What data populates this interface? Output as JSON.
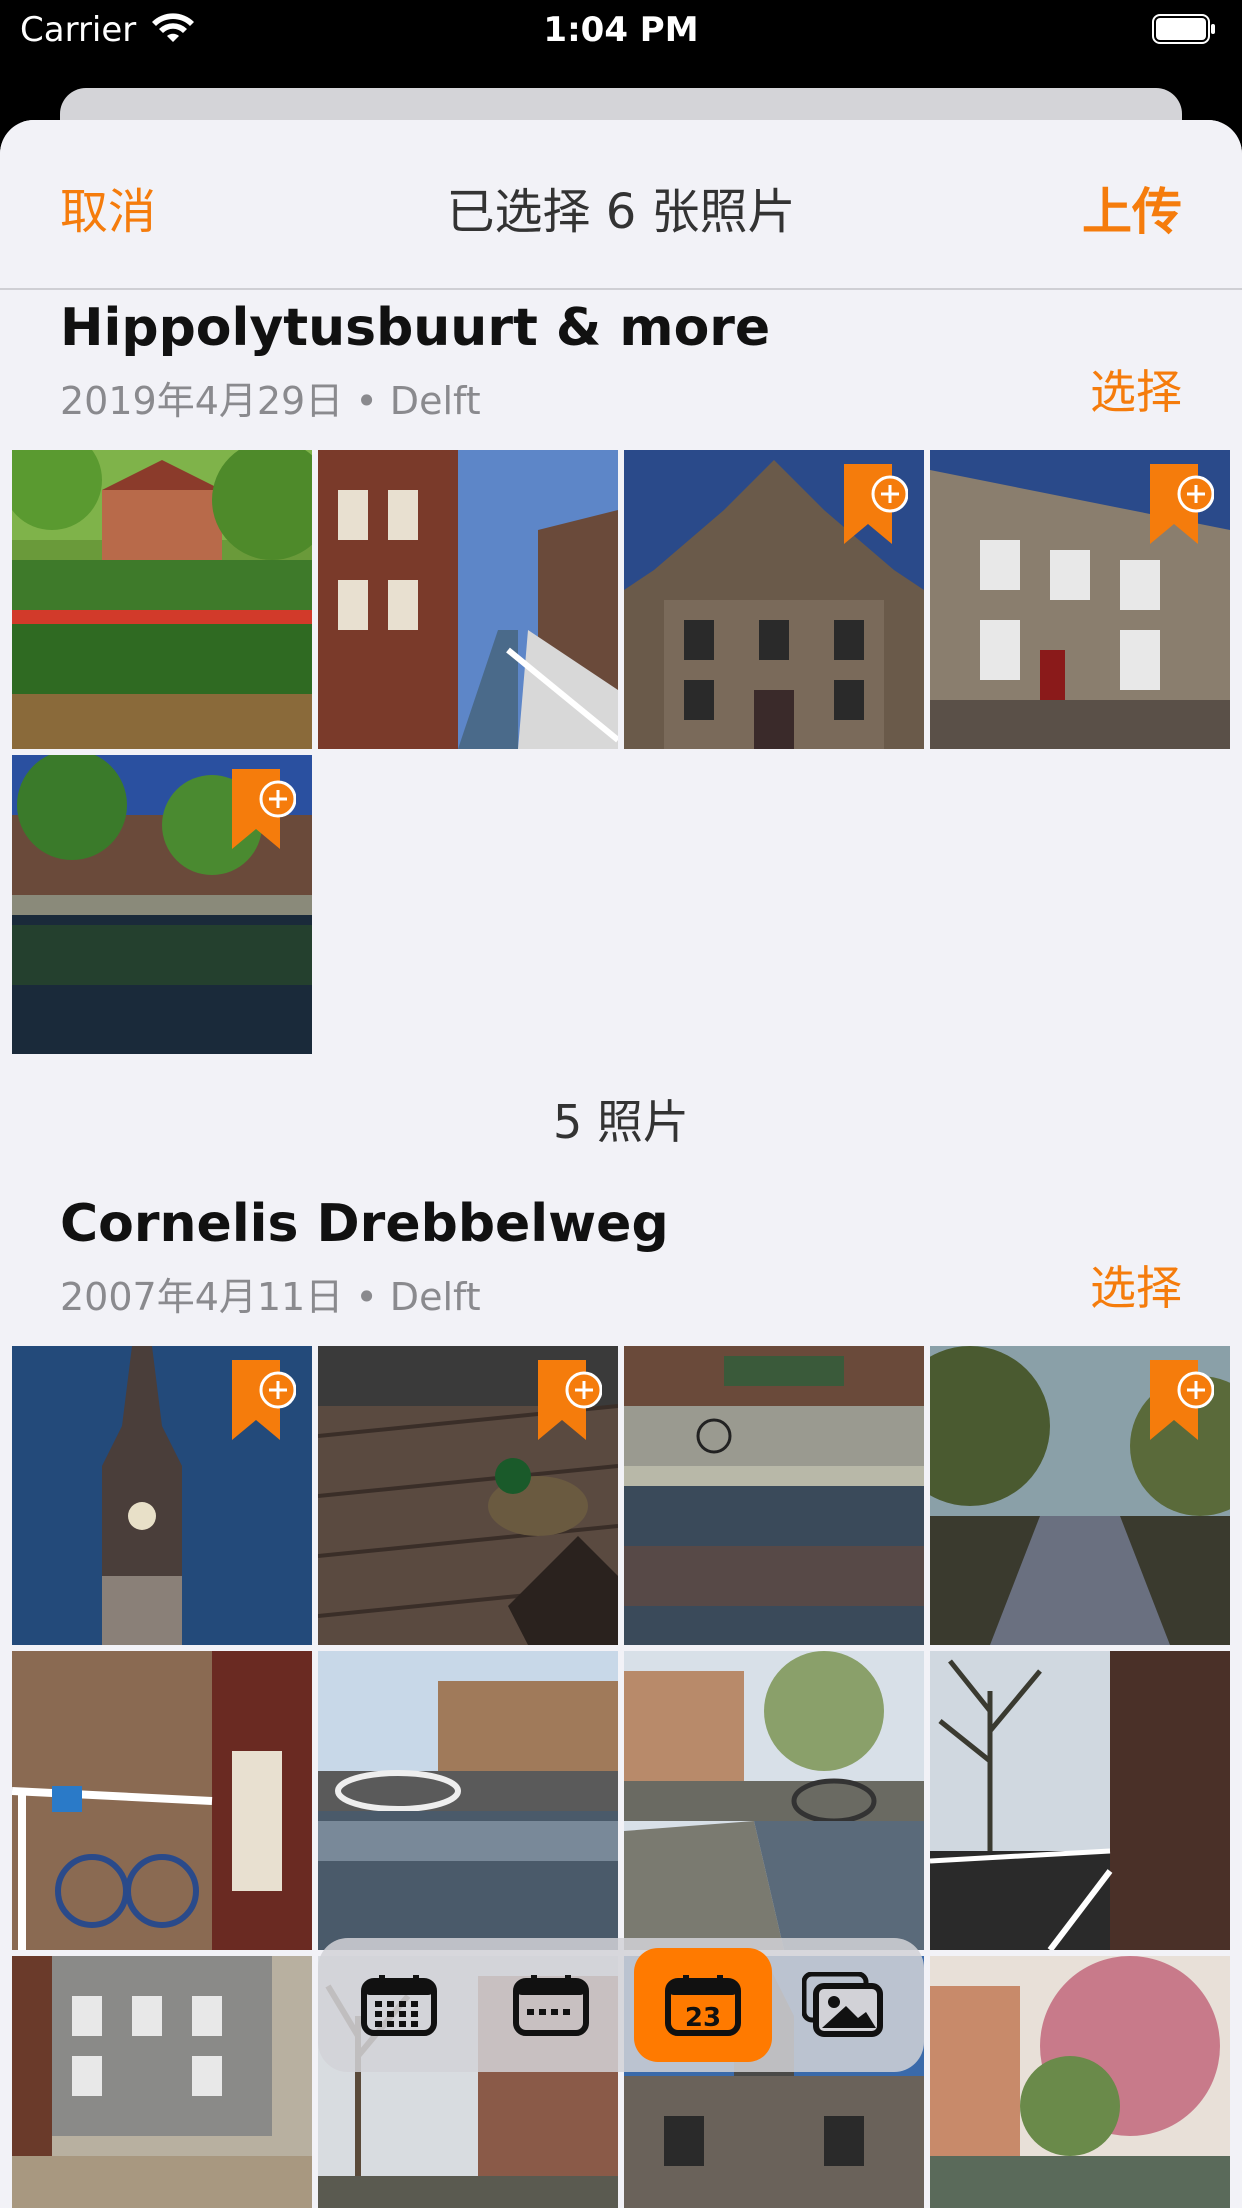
{
  "status_bar": {
    "carrier": "Carrier",
    "time": "1:04 PM"
  },
  "nav": {
    "cancel": "取消",
    "title": "已选择 6 张照片",
    "upload": "上传"
  },
  "sections": [
    {
      "title": "Hippolytusbuurt & more",
      "subtitle": "2019年4月29日 • Delft",
      "select": "选择",
      "count_label": "5 照片",
      "photos": [
        {
          "scene": "garden-tulips",
          "bookmark": false
        },
        {
          "scene": "canal-street",
          "bookmark": false
        },
        {
          "scene": "city-hall",
          "bookmark": true
        },
        {
          "scene": "stone-building",
          "bookmark": true
        },
        {
          "scene": "canal-reflection",
          "bookmark": true
        }
      ]
    },
    {
      "title": "Cornelis Drebbelweg",
      "subtitle": "2007年4月11日 • Delft",
      "select": "选择",
      "photos": [
        {
          "scene": "church-tower",
          "bookmark": true
        },
        {
          "scene": "duck-bricks",
          "bookmark": true
        },
        {
          "scene": "canal-bikes",
          "bookmark": false
        },
        {
          "scene": "tree-canal",
          "bookmark": true
        },
        {
          "scene": "blue-bike",
          "bookmark": false
        },
        {
          "scene": "bridge-canal",
          "bookmark": false
        },
        {
          "scene": "canal-bridge-2",
          "bookmark": false
        },
        {
          "scene": "bare-trees",
          "bookmark": false
        },
        {
          "scene": "square",
          "bookmark": false
        },
        {
          "scene": "street-trees",
          "bookmark": false
        },
        {
          "scene": "spire",
          "bookmark": false
        },
        {
          "scene": "blossom",
          "bookmark": false
        }
      ]
    }
  ],
  "tabbar": {
    "tabs": [
      {
        "icon": "calendar-year-icon",
        "active": false
      },
      {
        "icon": "calendar-month-icon",
        "active": false
      },
      {
        "icon": "calendar-day-icon",
        "active": true,
        "day": "23"
      },
      {
        "icon": "photos-icon",
        "active": false
      }
    ]
  },
  "colors": {
    "accent": "#f57c0c",
    "sheet_bg": "#f2f2f7"
  }
}
